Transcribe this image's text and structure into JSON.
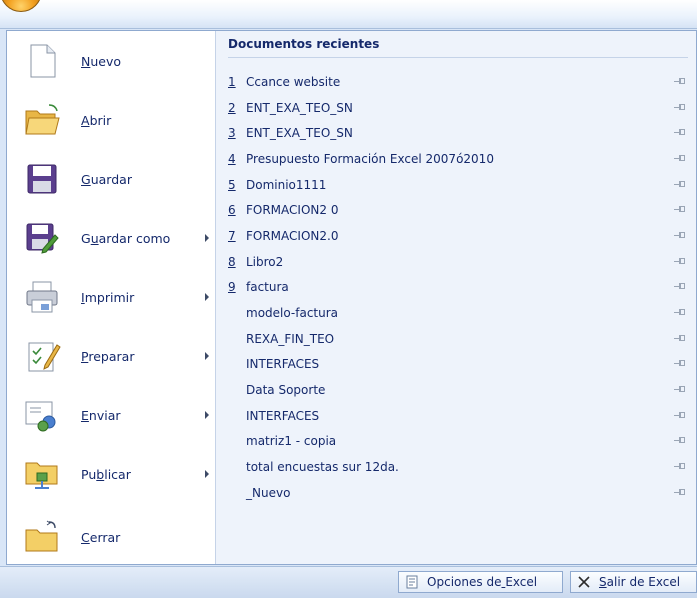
{
  "menu": {
    "items": [
      {
        "label": "Nuevo",
        "accel_index": 0,
        "icon": "new-document-icon",
        "has_submenu": false
      },
      {
        "label": "Abrir",
        "accel_index": 0,
        "icon": "open-folder-icon",
        "has_submenu": false
      },
      {
        "label": "Guardar",
        "accel_index": 0,
        "icon": "save-disk-icon",
        "has_submenu": false
      },
      {
        "label": "Guardar como",
        "accel_index": 1,
        "icon": "save-as-icon",
        "has_submenu": true
      },
      {
        "label": "Imprimir",
        "accel_index": 0,
        "icon": "printer-icon",
        "has_submenu": true
      },
      {
        "label": "Preparar",
        "accel_index": 0,
        "icon": "prepare-icon",
        "has_submenu": true
      },
      {
        "label": "Enviar",
        "accel_index": 0,
        "icon": "send-icon",
        "has_submenu": true
      },
      {
        "label": "Publicar",
        "accel_index": 2,
        "icon": "publish-icon",
        "has_submenu": true
      },
      {
        "label": "Cerrar",
        "accel_index": 0,
        "icon": "close-folder-icon",
        "has_submenu": false
      }
    ]
  },
  "recent": {
    "title": "Documentos recientes",
    "items": [
      {
        "num": "1",
        "name": "Ccance website"
      },
      {
        "num": "2",
        "name": "ENT_EXA_TEO_SN"
      },
      {
        "num": "3",
        "name": "ENT_EXA_TEO_SN"
      },
      {
        "num": "4",
        "name": "Presupuesto Formación Excel 2007ó2010"
      },
      {
        "num": "5",
        "name": "Dominio1111"
      },
      {
        "num": "6",
        "name": "FORMACION2 0"
      },
      {
        "num": "7",
        "name": "FORMACION2.0"
      },
      {
        "num": "8",
        "name": "Libro2"
      },
      {
        "num": "9",
        "name": "factura"
      },
      {
        "num": "",
        "name": "modelo-factura"
      },
      {
        "num": "",
        "name": "REXA_FIN_TEO"
      },
      {
        "num": "",
        "name": "INTERFACES"
      },
      {
        "num": "",
        "name": "Data Soporte"
      },
      {
        "num": "",
        "name": "INTERFACES"
      },
      {
        "num": "",
        "name": "matriz1 - copia"
      },
      {
        "num": "",
        "name": "total encuestas sur 12da."
      },
      {
        "num": "",
        "name": "_Nuevo"
      }
    ]
  },
  "footer": {
    "options_label": "Opciones de Excel",
    "options_accel_index": 11,
    "exit_label": "Salir de Excel",
    "exit_accel_index": 0
  }
}
